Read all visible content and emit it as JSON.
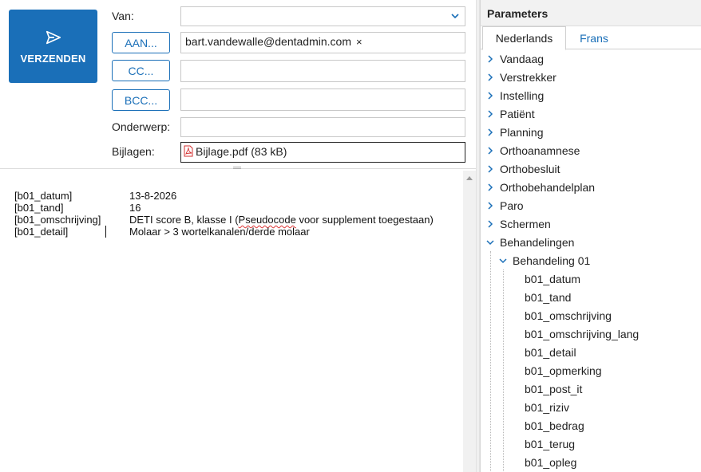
{
  "composer": {
    "send_label": "VERZENDEN",
    "van_label": "Van:",
    "van_value": "",
    "aan_button": "AAN...",
    "aan_value": "bart.vandewalle@dentadmin.com",
    "aan_remove": "×",
    "cc_button": "CC...",
    "cc_value": "",
    "bcc_button": "BCC...",
    "bcc_value": "",
    "onderwerp_label": "Onderwerp:",
    "onderwerp_value": "",
    "bijlagen_label": "Bijlagen:",
    "attachment": "Bijlage.pdf (83 kB)"
  },
  "body_lines": [
    {
      "key": "[b01_datum]",
      "value": "13-8-2026"
    },
    {
      "key": "[b01_tand]",
      "value": "16"
    },
    {
      "key": "[b01_omschrijving]",
      "value_pre": "DETI score B, klasse I (",
      "value_squig": "Pseudocode",
      "value_post": " voor supplement toegestaan)"
    },
    {
      "key": "[b01_detail]",
      "value": "Molaar > 3 wortelkanalen/derde molaar"
    }
  ],
  "params": {
    "title": "Parameters",
    "tabs": [
      "Nederlands",
      "Frans"
    ],
    "top_items": [
      "Vandaag",
      "Verstrekker",
      "Instelling",
      "Patiënt",
      "Planning",
      "Orthoanamnese",
      "Orthobesluit",
      "Orthobehandelplan",
      "Paro",
      "Schermen"
    ],
    "expanded": "Behandelingen",
    "sub_expanded": "Behandeling 01",
    "leaves": [
      "b01_datum",
      "b01_tand",
      "b01_omschrijving",
      "b01_omschrijving_lang",
      "b01_detail",
      "b01_opmerking",
      "b01_post_it",
      "b01_riziv",
      "b01_bedrag",
      "b01_terug",
      "b01_opleg"
    ]
  },
  "colors": {
    "accent": "#1a6fb8"
  }
}
